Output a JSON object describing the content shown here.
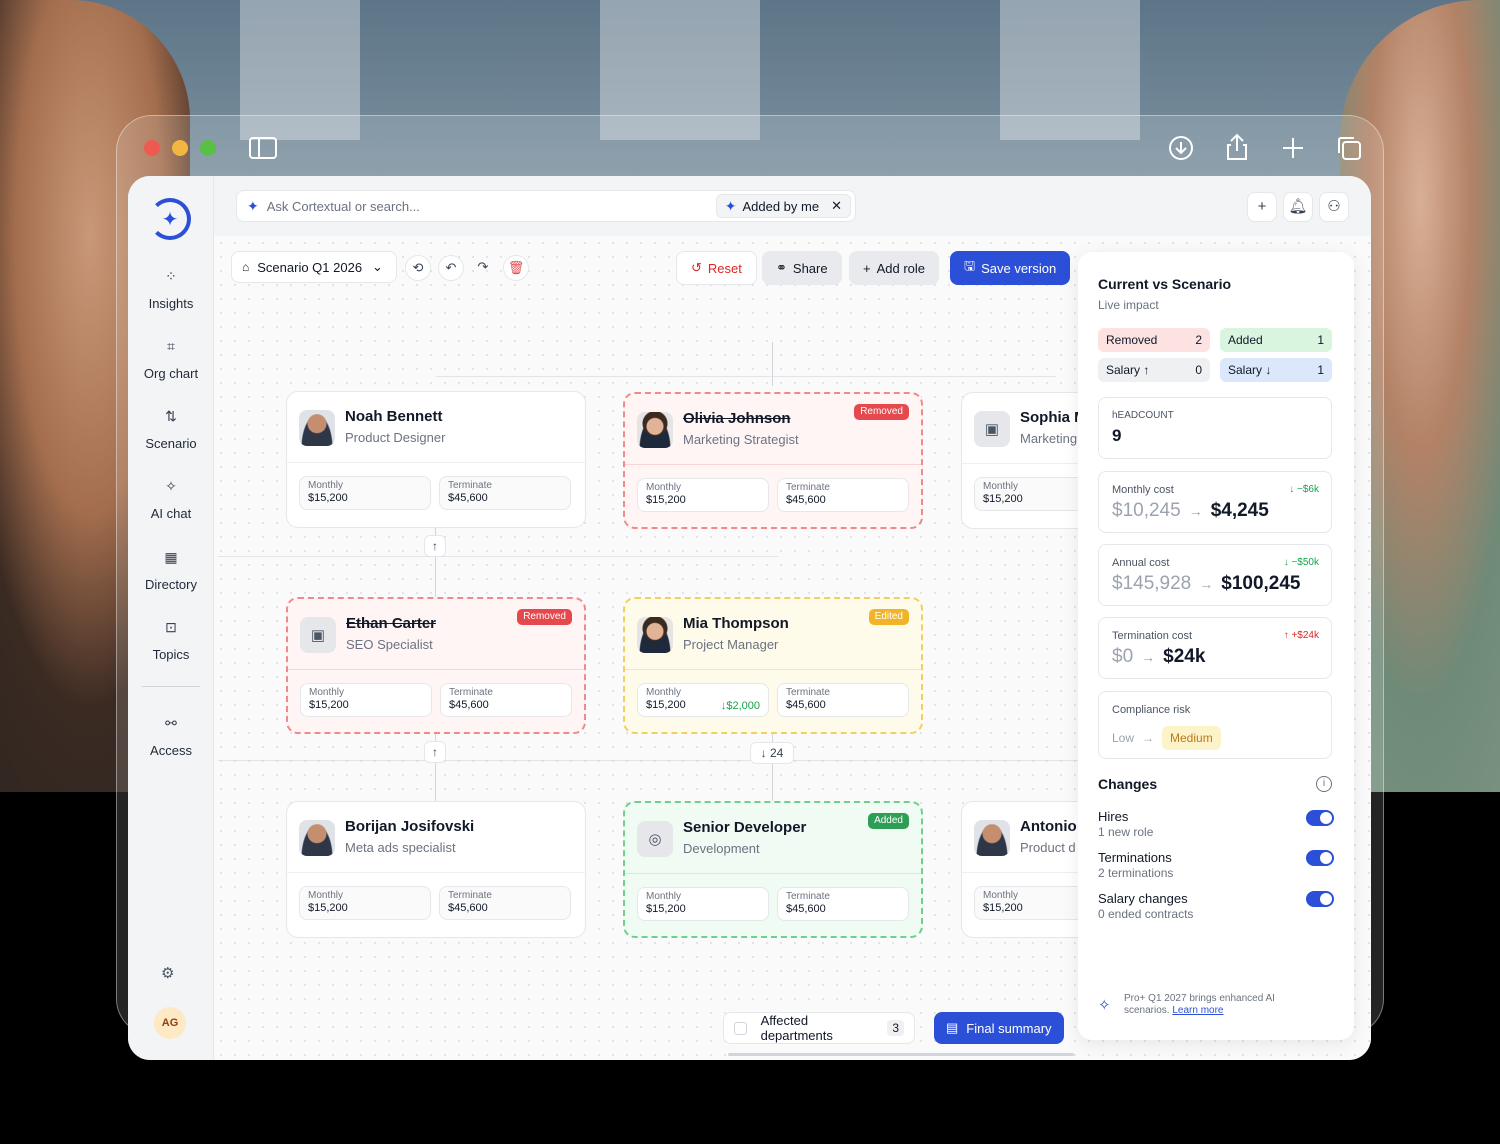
{
  "search": {
    "placeholder": "Ask Cortextual or search...",
    "chip": "Added by me"
  },
  "nav": [
    {
      "label": "Insights",
      "icon": "insights-icon"
    },
    {
      "label": "Org chart",
      "icon": "org-chart-icon"
    },
    {
      "label": "Scenario",
      "icon": "scenario-icon"
    },
    {
      "label": "AI chat",
      "icon": "sparkle-icon"
    },
    {
      "label": "Directory",
      "icon": "grid-icon"
    },
    {
      "label": "Topics",
      "icon": "topics-icon"
    },
    {
      "label": "Access",
      "icon": "access-icon"
    }
  ],
  "user": {
    "initials": "AG"
  },
  "toolbar": {
    "scenario": "Scenario Q1 2026",
    "reset": "Reset",
    "share": "Share",
    "add_role": "Add role",
    "save_version": "Save version"
  },
  "cards": [
    {
      "name": "Noah Bennett",
      "role": "Product Designer",
      "monthly_label": "Monthly",
      "monthly": "$15,200",
      "terminate_label": "Terminate",
      "terminate": "$45,600",
      "status": ""
    },
    {
      "name": "Olivia Johnson",
      "role": "Marketing Strategist",
      "monthly_label": "Monthly",
      "monthly": "$15,200",
      "terminate_label": "Terminate",
      "terminate": "$45,600",
      "status": "Removed"
    },
    {
      "name": "Sophia M",
      "role": "Marketing",
      "monthly_label": "Monthly",
      "monthly": "$15,200",
      "status": ""
    },
    {
      "name": "Ethan Carter",
      "role": "SEO Specialist",
      "monthly_label": "Monthly",
      "monthly": "$15,200",
      "terminate_label": "Terminate",
      "terminate": "$45,600",
      "status": "Removed"
    },
    {
      "name": "Mia Thompson",
      "role": "Project Manager",
      "monthly_label": "Monthly",
      "monthly": "$15,200",
      "delta": "↓$2,000",
      "terminate_label": "Terminate",
      "terminate": "$45,600",
      "status": "Edited"
    },
    {
      "name": "Borijan Josifovski",
      "role": "Meta ads specialist",
      "monthly_label": "Monthly",
      "monthly": "$15,200",
      "terminate_label": "Terminate",
      "terminate": "$45,600",
      "status": ""
    },
    {
      "name": "Senior Developer",
      "role": "Development",
      "monthly_label": "Monthly",
      "monthly": "$15,200",
      "terminate_label": "Terminate",
      "terminate": "$45,600",
      "status": "Added"
    },
    {
      "name": "Antonio",
      "role": "Product d",
      "monthly_label": "Monthly",
      "monthly": "$15,200",
      "status": ""
    }
  ],
  "expand_count": "24",
  "panel": {
    "title": "Current vs Scenario",
    "subtitle": "Live impact",
    "pills": [
      {
        "label": "Removed",
        "count": "2",
        "color": "#fde2e2"
      },
      {
        "label": "Added",
        "count": "1",
        "color": "#d9f5df"
      },
      {
        "label": "Salary ↑",
        "count": "0",
        "color": "#eef0f2"
      },
      {
        "label": "Salary ↓",
        "count": "1",
        "color": "#dbe7fb"
      }
    ],
    "headcount_label": "hEADCOUNT",
    "headcount": "9",
    "monthly": {
      "label": "Monthly cost",
      "change": "↓ −$6k",
      "old": "$10,245",
      "new": "$4,245"
    },
    "annual": {
      "label": "Annual cost",
      "change": "↓ −$50k",
      "old": "$145,928",
      "new": "$100,245"
    },
    "termination": {
      "label": "Termination cost",
      "change": "↑ +$24k",
      "old": "$0",
      "new": "$24k"
    },
    "compliance": {
      "label": "Compliance risk",
      "old": "Low",
      "new": "Medium"
    },
    "changes_title": "Changes",
    "changes": [
      {
        "label": "Hires",
        "sub": "1 new role",
        "on": true
      },
      {
        "label": "Terminations",
        "sub": "2 terminations",
        "on": true
      },
      {
        "label": "Salary changes",
        "sub": "0 ended contracts",
        "on": true
      }
    ],
    "promo_text": "Pro+ Q1 2027 brings enhanced AI scenarios.",
    "promo_link": "Learn more"
  },
  "bottom": {
    "affected_label": "Affected departments",
    "affected_count": "3",
    "final_summary": "Final summary"
  },
  "colors": {
    "accent": "#2c4fd8",
    "removed": "#e5484d",
    "edited": "#f0b429",
    "added": "#2f9e55"
  }
}
